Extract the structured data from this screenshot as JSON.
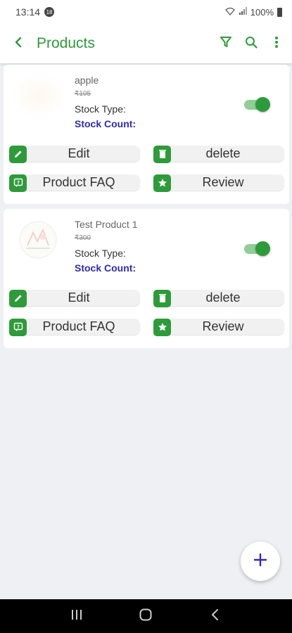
{
  "status_bar": {
    "time": "13:14",
    "notification_count": "18",
    "battery": "100%"
  },
  "app_bar": {
    "title": "Products",
    "icons": [
      "back-arrow-icon",
      "filter-icon",
      "search-icon",
      "more-vert-icon"
    ]
  },
  "products": [
    {
      "name": "apple",
      "price": "₹105",
      "stock_type_label": "Stock Type:",
      "stock_count_label": "Stock Count:",
      "enabled": true,
      "actions": {
        "edit": "Edit",
        "delete": "delete",
        "faq": "Product FAQ",
        "review": "Review"
      }
    },
    {
      "name": "Test Product 1",
      "price": "₹300",
      "stock_type_label": "Stock Type:",
      "stock_count_label": "Stock Count:",
      "enabled": true,
      "actions": {
        "edit": "Edit",
        "delete": "delete",
        "faq": "Product FAQ",
        "review": "Review"
      }
    }
  ],
  "fab": {
    "icon": "plus-icon"
  },
  "nav_bar": {
    "icons": [
      "recent-apps-icon",
      "home-icon",
      "back-icon"
    ]
  },
  "colors": {
    "accent": "#2e9b3a",
    "stock_count": "#2d2bb0"
  }
}
